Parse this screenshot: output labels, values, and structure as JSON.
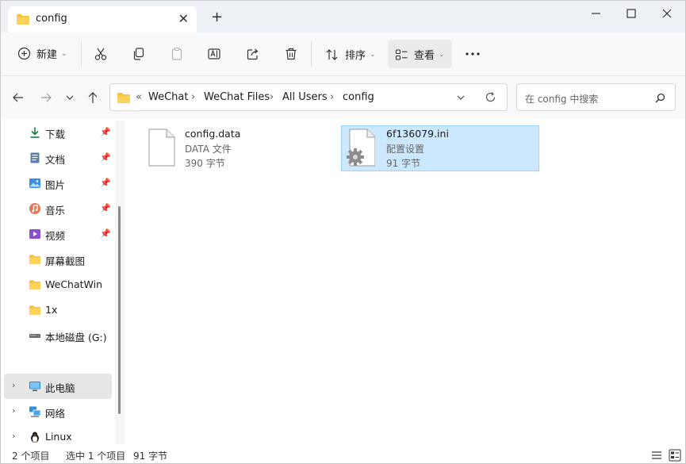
{
  "tab": {
    "title": "config"
  },
  "toolbar": {
    "new_label": "新建",
    "sort_label": "排序",
    "view_label": "查看"
  },
  "address": {
    "overflow": "«",
    "crumbs": [
      "WeChat",
      "WeChat Files",
      "All Users",
      "config"
    ]
  },
  "search": {
    "placeholder": "在 config 中搜索"
  },
  "sidebar": {
    "items": [
      {
        "label": "下载",
        "icon": "download-icon",
        "pinned": true
      },
      {
        "label": "文档",
        "icon": "document-icon",
        "pinned": true
      },
      {
        "label": "图片",
        "icon": "picture-icon",
        "pinned": true
      },
      {
        "label": "音乐",
        "icon": "music-icon",
        "pinned": true
      },
      {
        "label": "视频",
        "icon": "video-icon",
        "pinned": true
      },
      {
        "label": "屏幕截图",
        "icon": "folder-icon",
        "pinned": false
      },
      {
        "label": "WeChatWin",
        "icon": "folder-icon",
        "pinned": false
      },
      {
        "label": "1x",
        "icon": "folder-icon",
        "pinned": false
      },
      {
        "label": "本地磁盘 (G:)",
        "icon": "drive-icon",
        "pinned": false
      },
      {
        "label": "此电脑",
        "icon": "computer-icon",
        "pinned": false
      },
      {
        "label": "网络",
        "icon": "network-icon",
        "pinned": false
      },
      {
        "label": "Linux",
        "icon": "linux-icon",
        "pinned": false
      }
    ]
  },
  "files": [
    {
      "name": "config.data",
      "type": "DATA 文件",
      "size": "390 字节",
      "selected": false
    },
    {
      "name": "6f136079.ini",
      "type": "配置设置",
      "size": "91 字节",
      "selected": true
    }
  ],
  "status": {
    "count": "2 个项目",
    "selection": "选中 1 个项目",
    "size": "91 字节"
  },
  "colors": {
    "selection_fill": "#cce8ff",
    "selection_border": "#99d1ff",
    "folder_yellow": "#f8c33d"
  }
}
